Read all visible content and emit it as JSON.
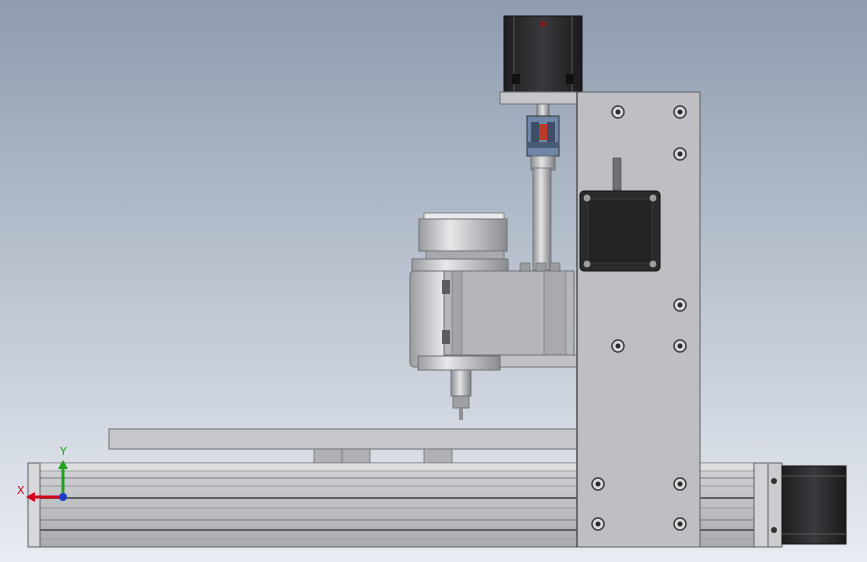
{
  "viewport": {
    "background_top": "#8F9BAE",
    "background_bottom": "#E8ECF2"
  },
  "colors": {
    "plate": "#B8BABD",
    "plate_dark": "#8E9094",
    "motor_dark": "#2A2A2C",
    "rail_light": "#C7C9CC",
    "spindle_light": "#D4D6D9",
    "coupling_blue": "#5A6E8C",
    "coupling_red": "#C0392B",
    "axis_x": "#D0021B",
    "axis_y": "#1FA31F",
    "axis_z": "#1E3FCC"
  },
  "triad": {
    "x_label": "X",
    "y_label": "Y"
  },
  "icons": [
    "stepper-motor-icon",
    "screw-hole-icon",
    "coordinate-triad-icon"
  ]
}
